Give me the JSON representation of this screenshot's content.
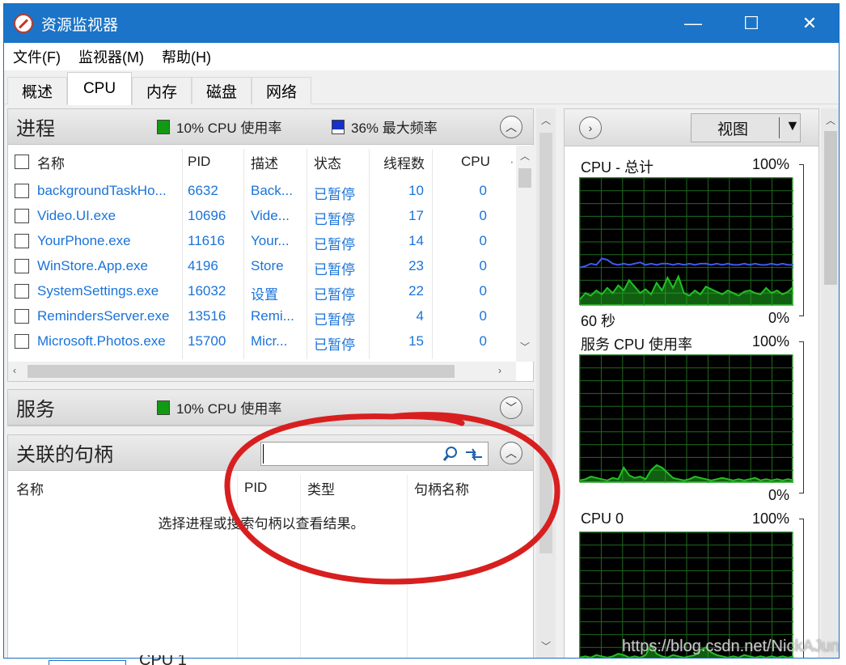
{
  "window": {
    "title": "资源监视器",
    "controls": [
      "—",
      "☐",
      "✕"
    ]
  },
  "menu": [
    "文件(F)",
    "监视器(M)",
    "帮助(H)"
  ],
  "tabs": [
    "概述",
    "CPU",
    "内存",
    "磁盘",
    "网络"
  ],
  "active_tab": "CPU",
  "processes": {
    "title": "进程",
    "cpu_usage": "10% CPU 使用率",
    "max_freq": "36% 最大频率",
    "columns": [
      "名称",
      "PID",
      "描述",
      "状态",
      "线程数",
      "CPU",
      "·"
    ],
    "rows": [
      {
        "name": "backgroundTaskHo...",
        "pid": "6632",
        "desc": "Back...",
        "status": "已暂停",
        "threads": "10",
        "cpu": "0"
      },
      {
        "name": "Video.UI.exe",
        "pid": "10696",
        "desc": "Vide...",
        "status": "已暂停",
        "threads": "17",
        "cpu": "0"
      },
      {
        "name": "YourPhone.exe",
        "pid": "11616",
        "desc": "Your...",
        "status": "已暂停",
        "threads": "14",
        "cpu": "0"
      },
      {
        "name": "WinStore.App.exe",
        "pid": "4196",
        "desc": "Store",
        "status": "已暂停",
        "threads": "23",
        "cpu": "0"
      },
      {
        "name": "SystemSettings.exe",
        "pid": "16032",
        "desc": "设置",
        "status": "已暂停",
        "threads": "22",
        "cpu": "0"
      },
      {
        "name": "RemindersServer.exe",
        "pid": "13516",
        "desc": "Remi...",
        "status": "已暂停",
        "threads": "4",
        "cpu": "0"
      },
      {
        "name": "Microsoft.Photos.exe",
        "pid": "15700",
        "desc": "Micr...",
        "status": "已暂停",
        "threads": "15",
        "cpu": "0"
      }
    ]
  },
  "services": {
    "title": "服务",
    "cpu_usage": "10% CPU 使用率"
  },
  "handles": {
    "title": "关联的句柄",
    "search_value": "",
    "columns": [
      "名称",
      "PID",
      "类型",
      "句柄名称"
    ],
    "empty_message": "选择进程或搜索句柄以查看结果。"
  },
  "right": {
    "view_label": "视图",
    "graphs": [
      {
        "title": "CPU - 总计",
        "max": "100%",
        "bottom_left": "60 秒",
        "bottom_right": "0%"
      },
      {
        "title": "服务 CPU 使用率",
        "max": "100%",
        "bottom_left": "",
        "bottom_right": "0%"
      },
      {
        "title": "CPU 0",
        "max": "100%",
        "bottom_left": "",
        "bottom_right": ""
      }
    ],
    "partial_label": "CPU 1"
  },
  "watermark": "https://blog.csdn.net/NickAJun",
  "colors": {
    "titlebar": "#1b74c7",
    "link": "#1a73d9",
    "graph_green": "#22c022",
    "graph_blue": "#3d5af1",
    "annotation_red": "#d81f1f"
  }
}
